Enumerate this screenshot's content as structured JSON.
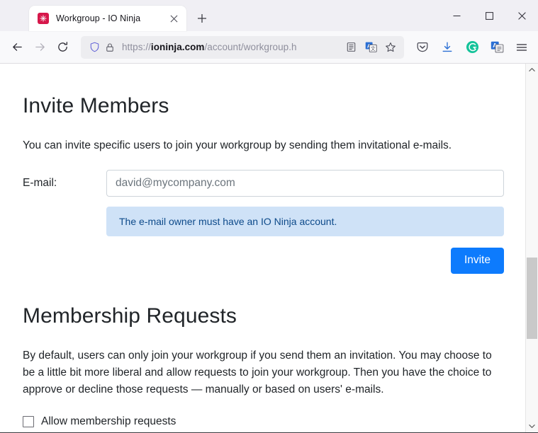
{
  "browser": {
    "tab": {
      "title": "Workgroup - IO Ninja",
      "favicon_name": "ioninja-star-icon",
      "close_label": "✕",
      "brand_color": "#d6174a"
    },
    "new_tab_label": "+",
    "window_controls": {
      "minimize": "—",
      "maximize": "□",
      "close": "✕"
    },
    "nav": {
      "back": "←",
      "forward": "→",
      "reload": "⟳"
    },
    "url": {
      "scheme": "https://",
      "host": "ioninja.com",
      "path": "/account/workgroup.h",
      "full": "https://ioninja.com/account/workgroup.h",
      "shield_icon": "tracking-protection-shield-icon",
      "lock_icon": "padlock-icon",
      "reader_icon": "reader-view-icon",
      "translate_icon": "translate-icon",
      "bookmark_icon": "bookmark-star-icon"
    },
    "toolbar_icons": [
      {
        "name": "pocket-icon",
        "label": "Save to Pocket"
      },
      {
        "name": "download-icon",
        "label": "Downloads"
      },
      {
        "name": "grammarly-icon",
        "label": "G",
        "color": "#15c39a"
      },
      {
        "name": "translate-extension-icon",
        "label": "A",
        "color": "#2b6fd4"
      },
      {
        "name": "app-menu-icon",
        "label": "Open application menu"
      }
    ],
    "scrollbar": {
      "up_arrow": "⌃",
      "down_arrow": "⌄",
      "thumb_top_pct": 52.8,
      "thumb_height_pct": 23.6
    }
  },
  "page": {
    "invite": {
      "heading": "Invite Members",
      "description": "You can invite specific users to join your workgroup by sending them invitational e-mails.",
      "email_label": "E-mail:",
      "email_placeholder": "david@mycompany.com",
      "email_value": "",
      "info_note": "The e-mail owner must have an IO Ninja account.",
      "info_bg": "#cfe2f7",
      "info_fg": "#0d4a8a",
      "invite_button": "Invite",
      "invite_button_color": "#0d7bfd"
    },
    "membership": {
      "heading": "Membership Requests",
      "description": "By default, users can only join your workgroup if you send them an invitation. You may choose to be a little bit more liberal and allow requests to join your workgroup. Then you have the choice to approve or decline those requests — manually or based on users' e-mails.",
      "checkbox_label": "Allow membership requests",
      "checkbox_checked": false
    }
  }
}
